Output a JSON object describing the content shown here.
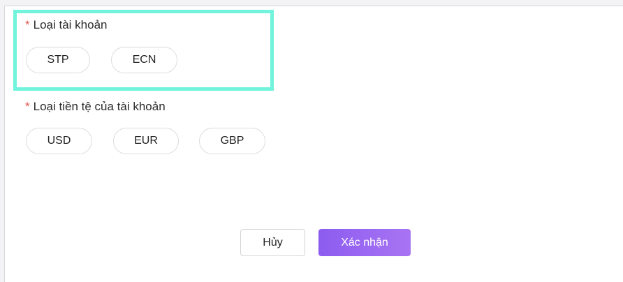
{
  "form": {
    "account_type": {
      "required_mark": "*",
      "label": "Loại tài khoản",
      "options": [
        "STP",
        "ECN"
      ]
    },
    "currency": {
      "required_mark": "*",
      "label": "Loại tiền tệ của tài khoản",
      "options": [
        "USD",
        "EUR",
        "GBP"
      ]
    }
  },
  "actions": {
    "cancel_label": "Hủy",
    "confirm_label": "Xác nhận"
  },
  "colors": {
    "highlight": "#72f4dc",
    "required": "#e2574c",
    "confirm_start": "#8c5cf0",
    "confirm_end": "#a874f3"
  }
}
